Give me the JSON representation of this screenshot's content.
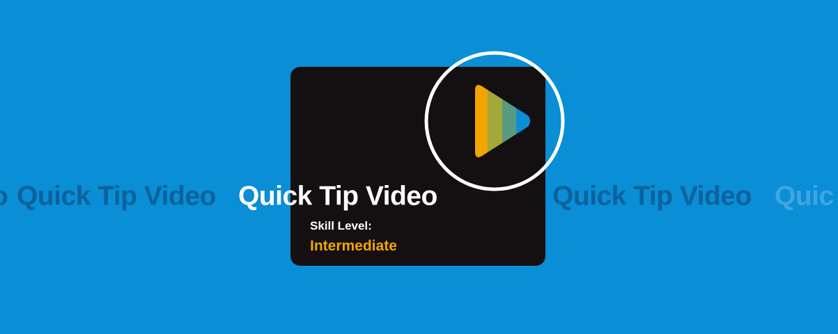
{
  "banner": {
    "background_color": "#0a8ed6",
    "ticker_fragment_left": "o",
    "ticker_left": "Quick Tip Video",
    "title": "Quick Tip Video",
    "ticker_right": "Quick Tip Video",
    "ticker_fragment_right": "Quic"
  },
  "card": {
    "background_color": "#141012",
    "skill_label": "Skill Level:",
    "skill_value": "Intermediate",
    "skill_value_color": "#f0a500"
  },
  "play_icon": {
    "name": "play-icon",
    "stripe_colors": [
      "#f0a500",
      "#a3a83a",
      "#5b9a80",
      "#0a8ed6"
    ],
    "ring_color": "#ffffff"
  }
}
